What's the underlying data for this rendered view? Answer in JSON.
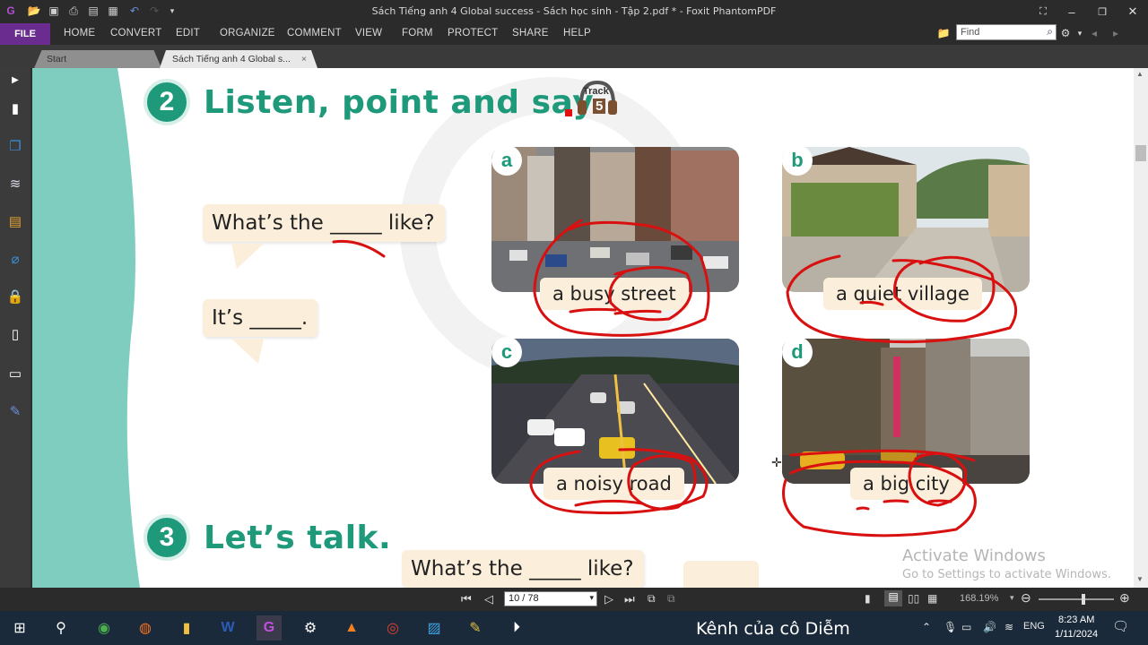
{
  "window": {
    "title": "Sách Tiếng anh 4 Global success - Sách học sinh - Tập 2.pdf * - Foxit PhantomPDF"
  },
  "ribbon": {
    "file": "FILE",
    "menus": [
      "HOME",
      "CONVERT",
      "EDIT",
      "ORGANIZE",
      "COMMENT",
      "VIEW",
      "FORM",
      "PROTECT",
      "SHARE",
      "HELP"
    ],
    "find_placeholder": "Find"
  },
  "tabs": {
    "start": "Start",
    "active": "Sách Tiếng anh 4 Global s...",
    "close": "×"
  },
  "page": {
    "section2": {
      "number": "2",
      "title": "Listen, point and say.",
      "track_label": "Track",
      "track_num": "5"
    },
    "bubble1": "What’s the _____ like?",
    "bubble2": "It’s _____.",
    "items": [
      {
        "letter": "a",
        "caption": "a busy street"
      },
      {
        "letter": "b",
        "caption": "a quiet village"
      },
      {
        "letter": "c",
        "caption": "a noisy road"
      },
      {
        "letter": "d",
        "caption": "a big city"
      }
    ],
    "section3": {
      "number": "3",
      "title": "Let’s talk."
    },
    "bubble3": "What’s the _____ like?"
  },
  "watermark": {
    "line1": "Activate Windows",
    "line2": "Go to Settings to activate Windows."
  },
  "status": {
    "page_indicator": "10 / 78",
    "zoom": "168.19%"
  },
  "taskbar": {
    "channel_text": "Kênh của cô Diễm",
    "lang": "ENG",
    "time": "8:23 AM",
    "date": "1/11/2024"
  },
  "colors": {
    "accent_green": "#1e9a7a",
    "annotation_red": "#d81010",
    "file_purple": "#6a2c8f"
  }
}
